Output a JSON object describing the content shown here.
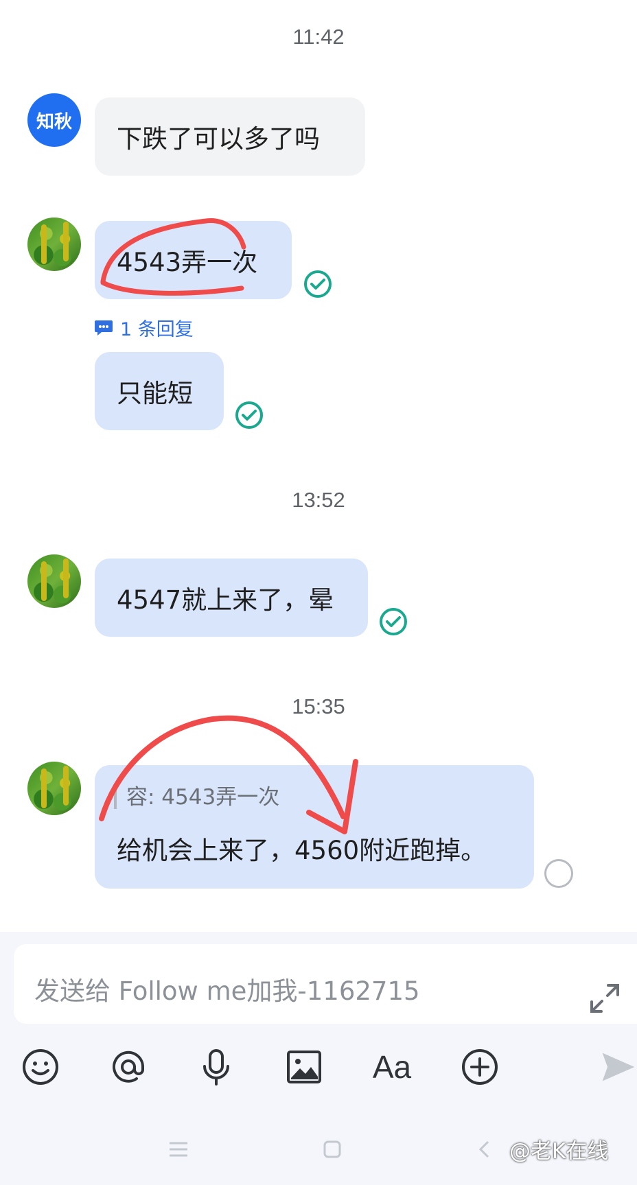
{
  "timestamps": [
    "11:42",
    "13:52",
    "15:35"
  ],
  "contacts": {
    "other_avatar_text": "知秋"
  },
  "messages": {
    "m1": "下跌了可以多了吗",
    "m2": "4543弄一次",
    "m2_reply_count": "1 条回复",
    "m3": "只能短",
    "m4": "4547就上来了，晕",
    "m5_quote": "容: 4543弄一次",
    "m5": "给机会上来了，4560附近跑掉。"
  },
  "input": {
    "placeholder": "发送给 Follow me加我-1162715"
  },
  "toolbar": {
    "icons": [
      "emoji-icon",
      "mention-icon",
      "mic-icon",
      "image-icon",
      "text-format-icon",
      "plus-icon",
      "send-icon"
    ],
    "format_label": "Aa"
  },
  "watermark": "@老K在线",
  "colors": {
    "accent": "#1f6ff0",
    "sent_bubble": "#d8e5fb",
    "received_bubble": "#f2f3f5",
    "read_check": "#1aa98f",
    "annotation": "#f04b4b"
  }
}
